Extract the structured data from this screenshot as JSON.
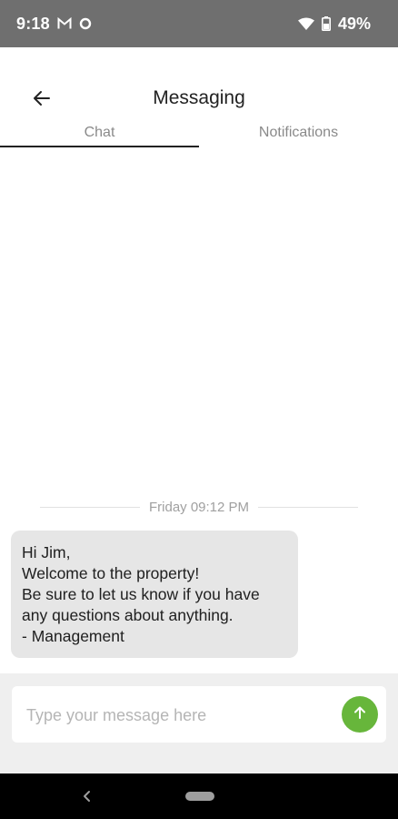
{
  "status_bar": {
    "time": "9:18",
    "battery_percent": "49%",
    "icons": [
      "gmail-icon",
      "sync-icon",
      "wifi-icon",
      "battery-icon"
    ]
  },
  "header": {
    "title": "Messaging",
    "back_icon": "arrow-left-icon"
  },
  "tabs": [
    {
      "label": "Chat",
      "active": true
    },
    {
      "label": "Notifications",
      "active": false
    }
  ],
  "chat": {
    "timestamp": "Friday 09:12 PM",
    "messages": [
      {
        "lines": [
          "Hi Jim,",
          "Welcome to the property!",
          "Be sure to let us know if you have",
          "any questions about anything.",
          "- Management"
        ]
      }
    ]
  },
  "composer": {
    "placeholder": "Type your message here",
    "value": "",
    "send_icon": "arrow-up-icon"
  },
  "colors": {
    "status_bar": "#6f6f6f",
    "accent": "#67b63b",
    "bubble": "#e6e6e6",
    "composer_background": "#efefef"
  }
}
